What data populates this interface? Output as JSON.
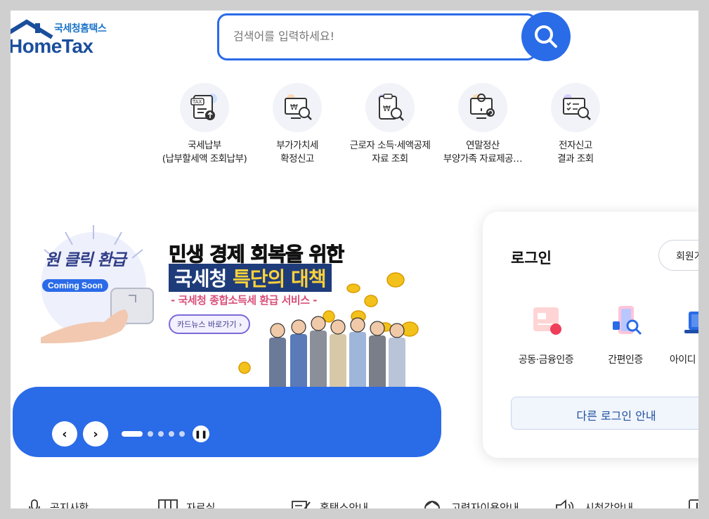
{
  "logo": {
    "sub": "국세청홈택스",
    "main": "HomeTax"
  },
  "search": {
    "placeholder": "검색어를 입력하세요!"
  },
  "quick_menu": [
    {
      "icon": "tax-payment-icon",
      "label": "국세납부\n(납부할세액 조회납부)"
    },
    {
      "icon": "vat-monitor-icon",
      "label": "부가가치세\n확정신고"
    },
    {
      "icon": "income-deduction-icon",
      "label": "근로자 소득·세액공제\n자료 조회"
    },
    {
      "icon": "year-end-settlement-icon",
      "label": "연말정산\n부양가족 자료제공…"
    },
    {
      "icon": "e-filing-result-icon",
      "label": "전자신고\n결과 조회"
    }
  ],
  "banner": {
    "badge": "원 클릭 환급",
    "soon": "Coming Soon",
    "headline1": "민생 경제 회복을 위한",
    "headline2_prefix": "국세청 ",
    "headline2_highlight": "특단의 대책",
    "subline": "- 국세청 종합소득세 환급 서비스 -",
    "card_news": "카드뉴스 바로가기",
    "slide_count": 5,
    "active_slide": 1
  },
  "login": {
    "title": "로그인",
    "join": "회원가입",
    "methods": [
      {
        "icon": "joint-certificate-icon",
        "label": "공동·금융인증"
      },
      {
        "icon": "simple-auth-icon",
        "label": "간편인증"
      },
      {
        "icon": "id-login-icon",
        "label": "아이디 로그인"
      }
    ],
    "other": "다른 로그인 안내"
  },
  "bottom_nav": [
    {
      "icon": "microphone-icon",
      "label": "공지사항"
    },
    {
      "icon": "archive-icon",
      "label": "자료실"
    },
    {
      "icon": "guide-icon",
      "label": "홈택스안내"
    },
    {
      "icon": "senior-icon",
      "label": "고령자이용안내"
    },
    {
      "icon": "speaker-icon",
      "label": "시청각안내"
    },
    {
      "icon": "alert-icon",
      "label": ""
    }
  ],
  "colors": {
    "primary": "#2a6be8",
    "logo": "#1a4e9c",
    "navy": "#1f3c7a"
  }
}
